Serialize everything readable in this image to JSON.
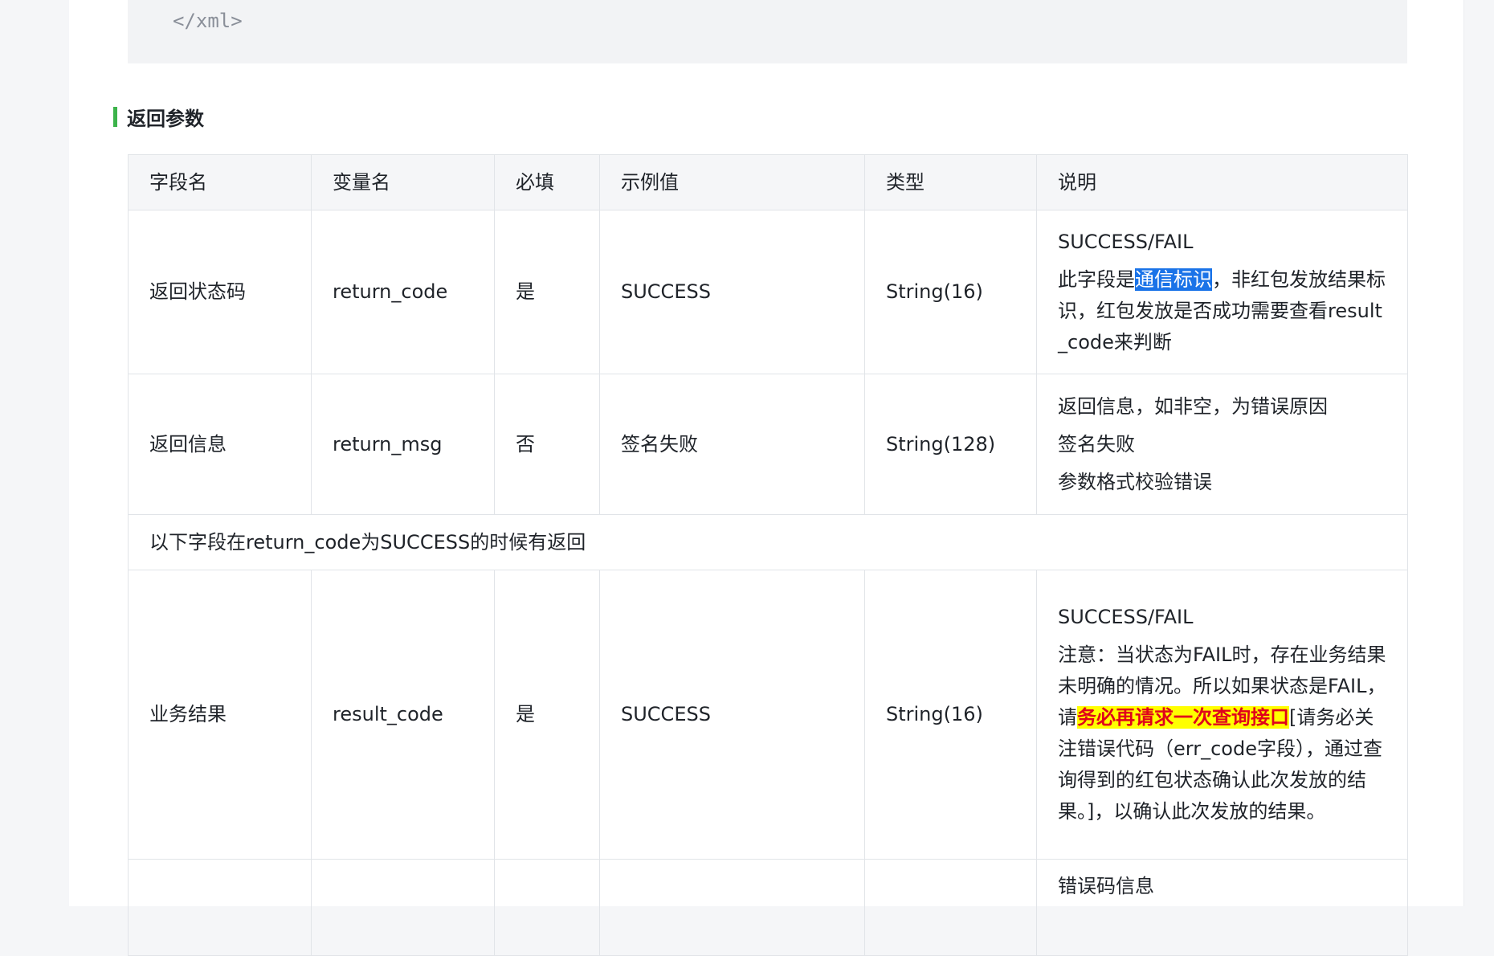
{
  "code": {
    "closing_tag": "</xml>"
  },
  "section": {
    "title": "返回参数"
  },
  "table": {
    "headers": [
      "字段名",
      "变量名",
      "必填",
      "示例值",
      "类型",
      "说明"
    ],
    "rows": [
      {
        "field": "返回状态码",
        "variable": "return_code",
        "required": "是",
        "example": "SUCCESS",
        "type": "String(16)",
        "desc_first": "SUCCESS/FAIL",
        "desc_pre": "此字段是",
        "desc_selected": "通信标识",
        "desc_post": "，非红包发放结果标识，红包发放是否成功需要查看result_code来判断"
      },
      {
        "field": "返回信息",
        "variable": "return_msg",
        "required": "否",
        "example": "签名失败",
        "type": "String(128)",
        "desc_lines": [
          "返回信息，如非空，为错误原因",
          "签名失败",
          "参数格式校验错误"
        ]
      },
      {
        "field": "业务结果",
        "variable": "result_code",
        "required": "是",
        "example": "SUCCESS",
        "type": "String(16)",
        "desc_first": "SUCCESS/FAIL",
        "desc_pre": "注意：当状态为FAIL时，存在业务结果未明确的情况。所以如果状态是FAIL，请",
        "desc_highlight": "务必再请求一次查询接口",
        "desc_post": "[请务必关注错误代码（err_code字段），通过查询得到的红包状态确认此次发放的结果。]，以确认此次发放的结果。"
      }
    ],
    "note": "以下字段在return_code为SUCCESS的时候有返回",
    "partial_desc": "错误码信息"
  }
}
